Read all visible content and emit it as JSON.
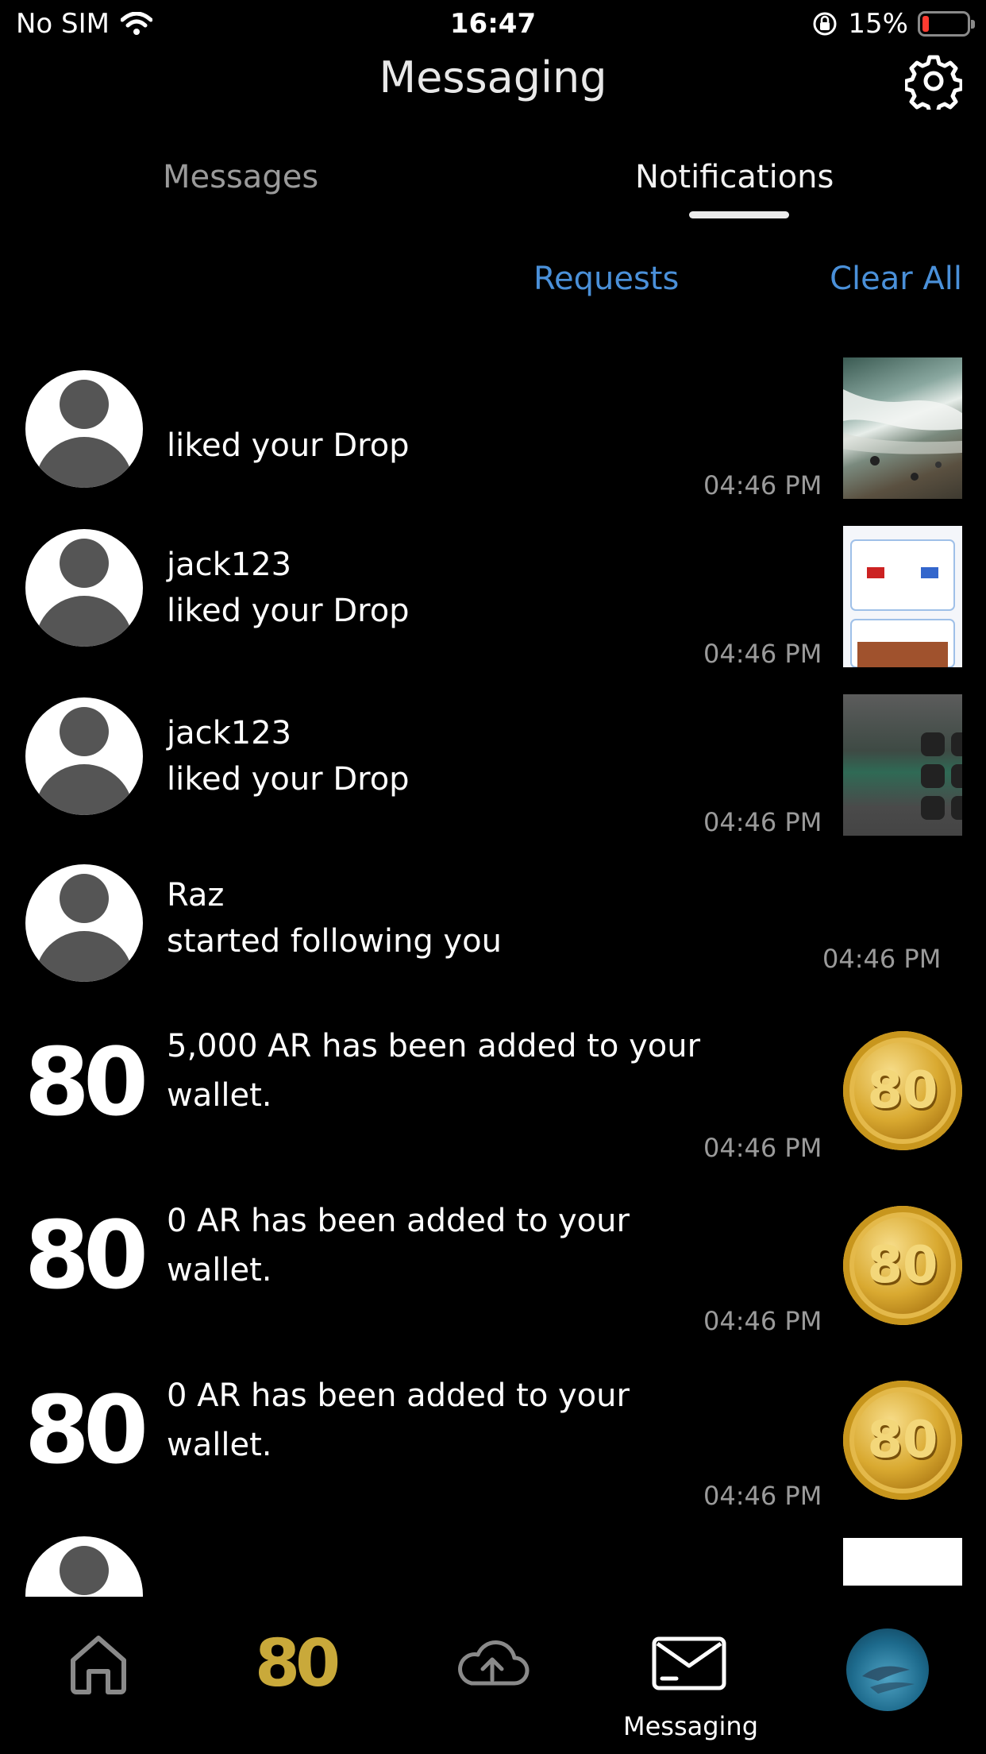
{
  "status_bar": {
    "carrier": "No SIM",
    "time": "16:47",
    "battery": "15%",
    "battery_level": 0.15
  },
  "header": {
    "title": "Messaging"
  },
  "tabs": [
    {
      "label": "Messages",
      "active": false
    },
    {
      "label": "Notifications",
      "active": true
    }
  ],
  "links": {
    "requests": "Requests",
    "clear_all": "Clear All"
  },
  "notifications": [
    {
      "user": "",
      "action": "liked your Drop",
      "time": "04:46 PM",
      "thumbnail": "beach-aerial-thumbnail"
    },
    {
      "user": "jack123",
      "action": "liked your Drop",
      "time": "04:46 PM",
      "thumbnail": "app-screenshot-thumbnail"
    },
    {
      "user": "jack123",
      "action": "liked your Drop",
      "time": "04:46 PM",
      "thumbnail": "control-center-thumbnail"
    },
    {
      "user": "Raz",
      "action": "started following you",
      "time": "04:46 PM"
    },
    {
      "brand": "80",
      "action": "5,000 AR has been added to your wallet.",
      "time": "04:46 PM",
      "coin": "80"
    },
    {
      "brand": "80",
      "action": "0 AR has been added to your wallet.",
      "time": "04:46 PM",
      "coin": "80"
    },
    {
      "brand": "80",
      "action": "0 AR has been added to your wallet.",
      "time": "04:46 PM",
      "coin": "80"
    }
  ],
  "nav": {
    "items": [
      "home-icon",
      "brand-80",
      "cloud-upload-icon",
      "envelope-icon",
      "profile-avatar"
    ],
    "brand_label": "80",
    "active_label": "Messaging"
  },
  "colors": {
    "accent_link": "#4a90d9",
    "brand_gold": "#c9a93a",
    "battery_low": "#ff3b30"
  }
}
